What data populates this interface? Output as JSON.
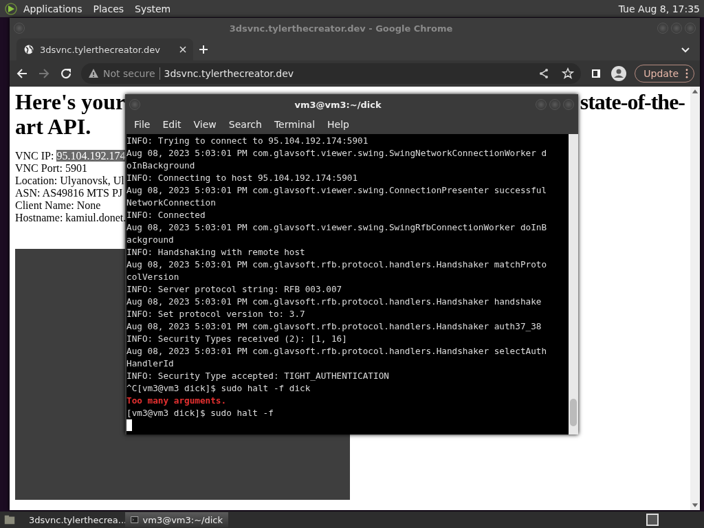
{
  "top_panel": {
    "menus": [
      "Applications",
      "Places",
      "System"
    ],
    "clock": "Tue Aug  8, 17:35"
  },
  "browser": {
    "title": "3dsvnc.tylerthecreator.dev - Google Chrome",
    "tabs": [
      {
        "label": "3dsvnc.tylerthecreator.dev",
        "selected": true
      }
    ],
    "forward_disabled": true,
    "security_label": "Not secure",
    "url": "3dsvnc.tylerthecreator.dev",
    "update_button": "Update",
    "page": {
      "heading_start": "Here's your",
      "heading_end": "state-of-the-",
      "heading_line2": "art API.",
      "info": [
        {
          "label": "VNC IP: ",
          "value": "95.104.192.174",
          "selected": true
        },
        {
          "label": "VNC Port: ",
          "value": "5901",
          "selected": false
        },
        {
          "label": "Location: ",
          "value": "Ulyanovsk, Ul",
          "selected": false
        },
        {
          "label": "ASN: ",
          "value": "AS49816 MTS PJ",
          "selected": false
        },
        {
          "label": "Client Name: ",
          "value": "None",
          "selected": false
        },
        {
          "label": "Hostname: ",
          "value": "kamiul.donet.",
          "selected": false
        }
      ]
    }
  },
  "terminal": {
    "title": "vm3@vm3:~/dick",
    "menus": [
      "File",
      "Edit",
      "View",
      "Search",
      "Terminal",
      "Help"
    ],
    "lines": [
      {
        "kind": "output",
        "text": "INFO: Trying to connect to 95.104.192.174:5901"
      },
      {
        "kind": "output",
        "text": "Aug 08, 2023 5:03:01 PM com.glavsoft.viewer.swing.SwingNetworkConnectionWorker d"
      },
      {
        "kind": "output",
        "text": "oInBackground"
      },
      {
        "kind": "output",
        "text": "INFO: Connecting to host 95.104.192.174:5901"
      },
      {
        "kind": "output",
        "text": "Aug 08, 2023 5:03:01 PM com.glavsoft.viewer.swing.ConnectionPresenter successful"
      },
      {
        "kind": "output",
        "text": "NetworkConnection"
      },
      {
        "kind": "output",
        "text": "INFO: Connected"
      },
      {
        "kind": "output",
        "text": "Aug 08, 2023 5:03:01 PM com.glavsoft.viewer.swing.SwingRfbConnectionWorker doInB"
      },
      {
        "kind": "output",
        "text": "ackground"
      },
      {
        "kind": "output",
        "text": "INFO: Handshaking with remote host"
      },
      {
        "kind": "output",
        "text": "Aug 08, 2023 5:03:01 PM com.glavsoft.rfb.protocol.handlers.Handshaker matchProto"
      },
      {
        "kind": "output",
        "text": "colVersion"
      },
      {
        "kind": "output",
        "text": "INFO: Server protocol string: RFB 003.007"
      },
      {
        "kind": "output",
        "text": "Aug 08, 2023 5:03:01 PM com.glavsoft.rfb.protocol.handlers.Handshaker handshake"
      },
      {
        "kind": "output",
        "text": "INFO: Set protocol version to: 3.7"
      },
      {
        "kind": "output",
        "text": "Aug 08, 2023 5:03:01 PM com.glavsoft.rfb.protocol.handlers.Handshaker auth37_38"
      },
      {
        "kind": "output",
        "text": "INFO: Security Types received (2): [1, 16]"
      },
      {
        "kind": "output",
        "text": "Aug 08, 2023 5:03:01 PM com.glavsoft.rfb.protocol.handlers.Handshaker selectAuth"
      },
      {
        "kind": "output",
        "text": "HandlerId"
      },
      {
        "kind": "output",
        "text": "INFO: Security Type accepted: TIGHT_AUTHENTICATION"
      },
      {
        "kind": "output",
        "text": "^C[vm3@vm3 dick]$ sudo halt -f dick"
      },
      {
        "kind": "error",
        "text": "Too many arguments."
      },
      {
        "kind": "output",
        "text": "[vm3@vm3 dick]$ sudo halt -f"
      }
    ]
  },
  "taskbar": {
    "items": [
      {
        "kind": "browser",
        "label": "3dsvnc.tylerthecrea...",
        "selected": false
      },
      {
        "kind": "terminal",
        "label": "vm3@vm3:~/dick",
        "selected": true
      }
    ]
  }
}
